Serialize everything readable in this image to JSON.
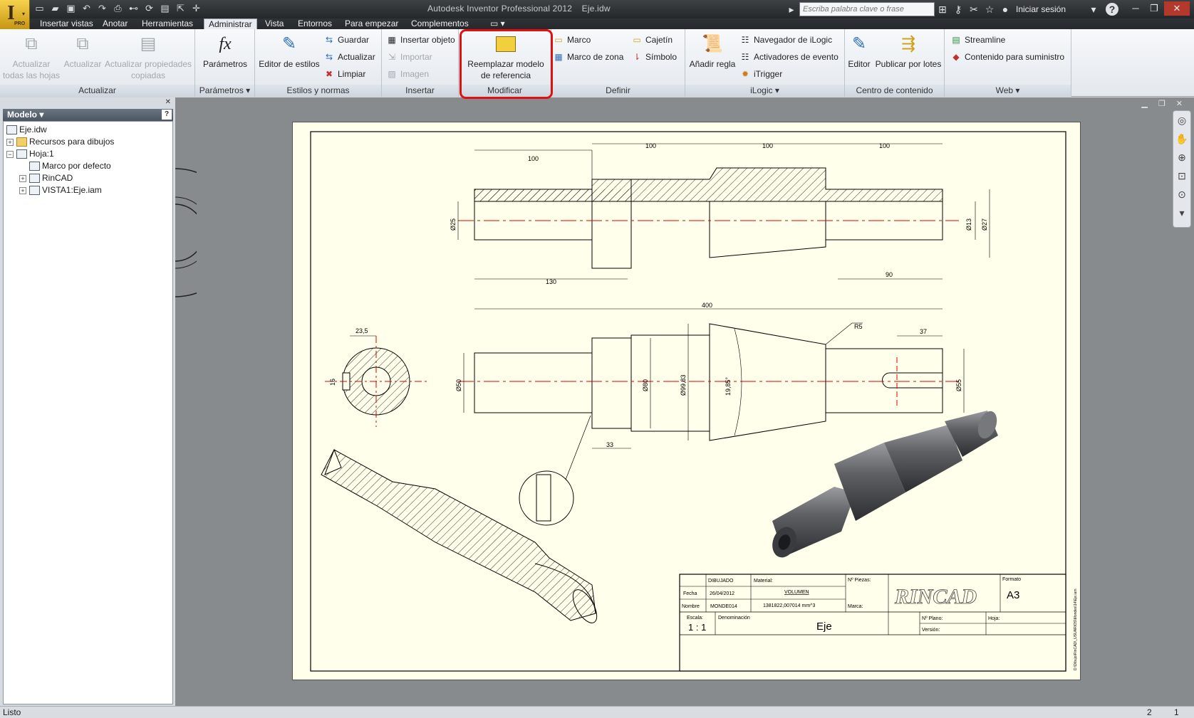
{
  "window": {
    "title": "Autodesk Inventor Professional 2012",
    "document": "Eje.idw",
    "search_placeholder": "Escriba palabra clave o frase",
    "signin": "Iniciar sesión",
    "help": "?"
  },
  "app_button": {
    "label": "I",
    "edition": "PRO"
  },
  "tabs": [
    {
      "label": "Insertar vistas"
    },
    {
      "label": "Anotar"
    },
    {
      "label": "Herramientas"
    },
    {
      "label": "Administrar"
    },
    {
      "label": "Vista"
    },
    {
      "label": "Entornos"
    },
    {
      "label": "Para empezar"
    },
    {
      "label": "Complementos"
    }
  ],
  "ribbon": {
    "actualizar": {
      "title": "Actualizar",
      "b1": "Actualizar todas las hojas",
      "b2": "Actualizar",
      "b3": "Actualizar propiedades copiadas"
    },
    "parametros": {
      "title": "Parámetros",
      "b1": "Parámetros",
      "icon_text": "fx"
    },
    "estilos": {
      "title": "Estilos y normas",
      "b1": "Editor de estilos",
      "s1": "Guardar",
      "s2": "Actualizar",
      "s3": "Limpiar"
    },
    "insertar": {
      "title": "Insertar",
      "s1": "Insertar objeto",
      "s2": "Importar",
      "s3": "Imagen"
    },
    "modificar": {
      "title": "Modificar",
      "b1": "Reemplazar modelo de referencia"
    },
    "definir": {
      "title": "Definir",
      "s1": "Marco",
      "s2": "Marco de zona",
      "s3": "Cajetín",
      "s4": "Símbolo"
    },
    "ilogic": {
      "title": "iLogic",
      "b1": "Añadir regla",
      "s1": "Navegador de iLogic",
      "s2": "Activadores de evento",
      "s3": "iTrigger"
    },
    "contenido": {
      "title": "Centro de contenido",
      "b1": "Editor",
      "b2": "Publicar por lotes"
    },
    "web": {
      "title": "Web",
      "s1": "Streamline",
      "s2": "Contenido para suministro"
    }
  },
  "browser": {
    "header": "Modelo",
    "help": "?",
    "tree": [
      {
        "label": "Eje.idw"
      },
      {
        "label": "Recursos para dibujos"
      },
      {
        "label": "Hoja:1"
      },
      {
        "label": "Marco por defecto"
      },
      {
        "label": "RinCAD"
      },
      {
        "label": "VISTA1:Eje.iam"
      }
    ]
  },
  "drawing": {
    "dims": {
      "d100a": "100",
      "d100b": "100",
      "d100c": "100",
      "d100d": "100",
      "d130": "130",
      "d90": "90",
      "d25": "Ø25",
      "d13": "Ø13",
      "d27": "Ø27",
      "d400": "400",
      "d235": "23,5",
      "d16": "16",
      "d50": "Ø50",
      "d80": "Ø80",
      "d9983": "Ø99,83",
      "d1985": "19,85°",
      "r5": "R5",
      "d37": "37",
      "d55": "Ø55",
      "d33": "33"
    },
    "titleblock": {
      "dibujado": "DIBUJADO",
      "material": "Material:",
      "npiezas": "Nº Piezas:",
      "formato_lbl": "Formato",
      "formato": "A3",
      "fecha_lbl": "Fecha",
      "fecha": "26/04/2012",
      "volumen_lbl": "VOLUMEN",
      "volumen": "1381822,007014  mm^3",
      "nombre_lbl": "Nombre",
      "nombre": "MONDE014",
      "marca": "Marca:",
      "escala_lbl": "Escala:",
      "escala": "1 : 1",
      "denominacion_lbl": "Denominación",
      "denominacion": "Eje",
      "nplano": "Nº Plano:",
      "hoja": "Hoja:",
      "version": "Versión:",
      "logo": "RINCAD",
      "path": "D:\\Dibujo\\RinCAD\\_USUARIOS\\Mondes\\14\\Eje.iam"
    }
  },
  "status": {
    "text": "Listo",
    "n1": "2",
    "n2": "1"
  }
}
